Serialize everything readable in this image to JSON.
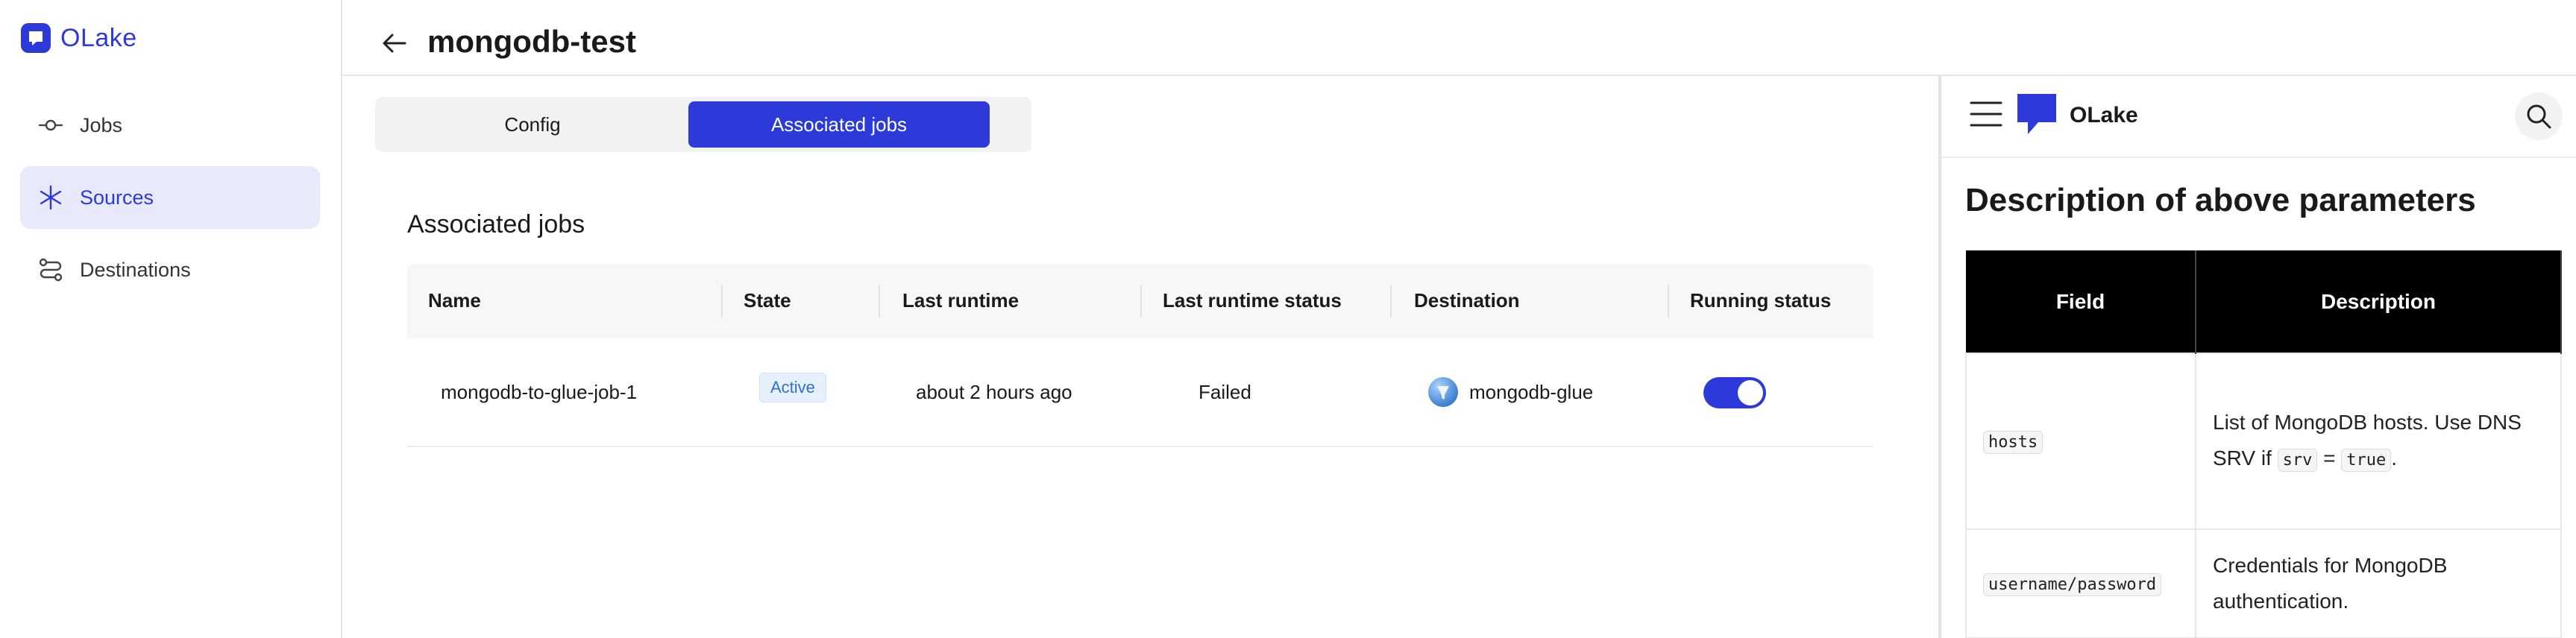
{
  "app": {
    "logo_text": "OLake"
  },
  "sidebar": {
    "items": [
      {
        "label": "Jobs",
        "icon": "commit-icon",
        "active": false
      },
      {
        "label": "Sources",
        "icon": "sparkle-icon",
        "active": true
      },
      {
        "label": "Destinations",
        "icon": "route-icon",
        "active": false
      }
    ]
  },
  "header": {
    "title": "mongodb-test"
  },
  "tabs": [
    {
      "label": "Config",
      "selected": false
    },
    {
      "label": "Associated jobs",
      "selected": true
    }
  ],
  "jobs_section": {
    "title": "Associated jobs",
    "columns": [
      "Name",
      "State",
      "Last runtime",
      "Last runtime status",
      "Destination",
      "Running status"
    ],
    "rows": [
      {
        "name": "mongodb-to-glue-job-1",
        "state": "Active",
        "last_runtime": "about 2 hours ago",
        "last_runtime_status": "Failed",
        "destination": "mongodb-glue",
        "running": true
      }
    ]
  },
  "docs": {
    "logo_text": "OLake",
    "heading": "Description of above parameters",
    "table": {
      "headers": [
        "Field",
        "Description"
      ],
      "rows": [
        {
          "field": "hosts",
          "desc_part1": "List of MongoDB hosts. Use DNS SRV if ",
          "code1": "srv",
          "desc_part2": " = ",
          "code2": "true",
          "desc_part3": "."
        },
        {
          "field": "username/password",
          "desc": "Credentials for MongoDB authentication."
        }
      ]
    }
  },
  "colors": {
    "accent": "#2b3ad8",
    "badge_bg": "#e6f1fd",
    "active_nav_bg": "#e8eafb"
  }
}
